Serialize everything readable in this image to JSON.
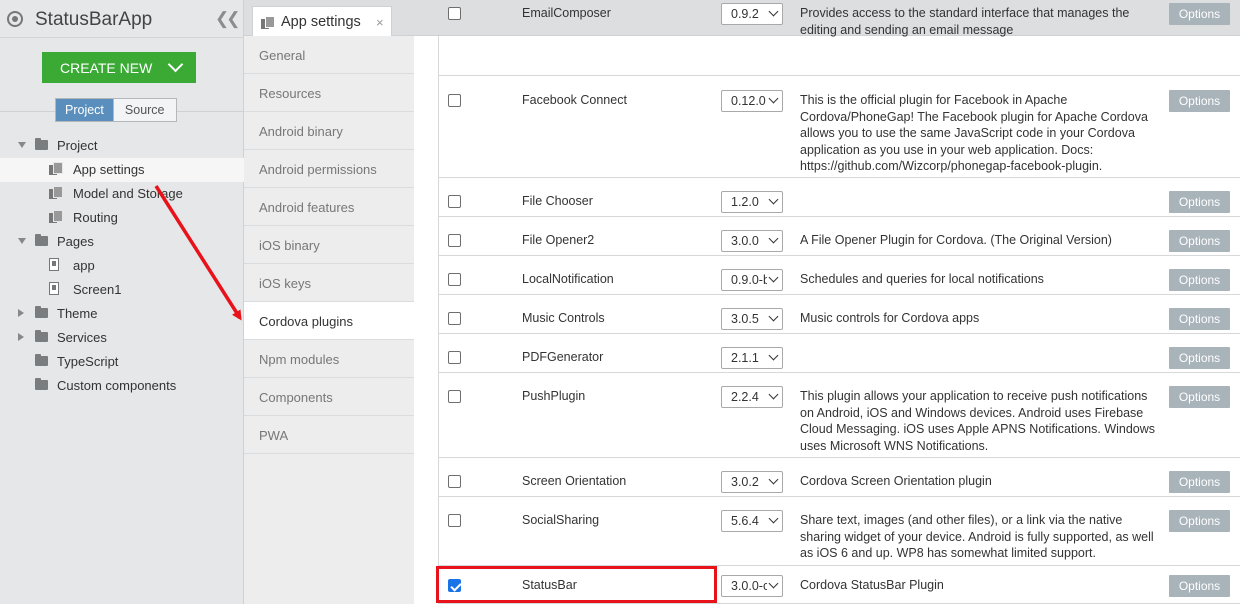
{
  "app": {
    "title": "StatusBarApp",
    "create_new_label": "CREATE NEW"
  },
  "panel_tabs": {
    "project": "Project",
    "source": "Source"
  },
  "tree": [
    {
      "label": "Project",
      "type": "folder",
      "toggle": "expanded"
    },
    {
      "label": "App settings",
      "type": "settings"
    },
    {
      "label": "Model and Storage",
      "type": "settings"
    },
    {
      "label": "Routing",
      "type": "settings"
    },
    {
      "label": "Pages",
      "type": "folder",
      "toggle": "expanded"
    },
    {
      "label": "app",
      "type": "doc"
    },
    {
      "label": "Screen1",
      "type": "doc"
    },
    {
      "label": "Theme",
      "type": "folder",
      "toggle": "collapsed"
    },
    {
      "label": "Services",
      "type": "folder",
      "toggle": "collapsed"
    },
    {
      "label": "TypeScript",
      "type": "folder"
    },
    {
      "label": "Custom components",
      "type": "folder"
    }
  ],
  "editor_tab": {
    "label": "App settings",
    "close": "×"
  },
  "settings_nav": [
    "General",
    "Resources",
    "Android binary",
    "Android permissions",
    "Android features",
    "iOS binary",
    "iOS keys",
    "Cordova plugins",
    "Npm modules",
    "Components",
    "PWA"
  ],
  "settings_nav_active": "Cordova plugins",
  "options_label": "Options",
  "plugins": [
    {
      "name": "EmailComposer",
      "version": "0.9.2",
      "checked": false,
      "description": "Provides access to the standard interface that manages the editing and sending an email message"
    },
    {
      "name": "Facebook Connect",
      "version": "0.12.0",
      "checked": false,
      "description": "This is the official plugin for Facebook in Apache Cordova/PhoneGap! The Facebook plugin for Apache Cordova allows you to use the same JavaScript code in your Cordova application as you use in your web application. Docs: https://github.com/Wizcorp/phonegap-facebook-plugin."
    },
    {
      "name": "File Chooser",
      "version": "1.2.0",
      "checked": false,
      "description": ""
    },
    {
      "name": "File Opener2",
      "version": "3.0.0",
      "checked": false,
      "description": "A File Opener Plugin for Cordova. (The Original Version)"
    },
    {
      "name": "LocalNotification",
      "version": "0.9.0-b",
      "checked": false,
      "description": "Schedules and queries for local notifications"
    },
    {
      "name": "Music Controls",
      "version": "3.0.5",
      "checked": false,
      "description": "Music controls for Cordova apps"
    },
    {
      "name": "PDFGenerator",
      "version": "2.1.1",
      "checked": false,
      "description": ""
    },
    {
      "name": "PushPlugin",
      "version": "2.2.4",
      "checked": false,
      "description": "This plugin allows your application to receive push notifications on Android, iOS and Windows devices. Android uses Firebase Cloud Messaging. iOS uses Apple APNS Notifications. Windows uses Microsoft WNS Notifications."
    },
    {
      "name": "Screen Orientation",
      "version": "3.0.2",
      "checked": false,
      "description": "Cordova Screen Orientation plugin"
    },
    {
      "name": "SocialSharing",
      "version": "5.6.4",
      "checked": false,
      "description": "Share text, images (and other files), or a link via the native sharing widget of your device. Android is fully supported, as well as iOS 6 and up. WP8 has somewhat limited support."
    },
    {
      "name": "StatusBar",
      "version": "3.0.0-c",
      "checked": true,
      "description": "Cordova StatusBar Plugin"
    }
  ],
  "colors": {
    "create_new": "#3aaa35",
    "selected_segment": "#5a8fbd",
    "options_button": "#a9b3ba",
    "annotation": "#e8121a",
    "checkbox_checked": "#1b73e8"
  }
}
